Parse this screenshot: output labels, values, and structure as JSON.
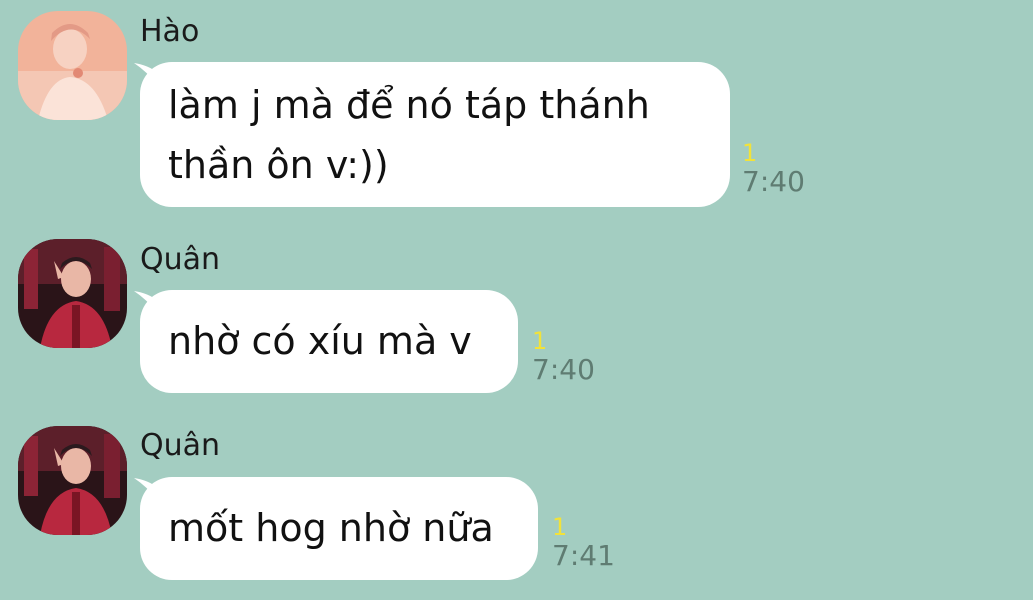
{
  "messages": [
    {
      "sender": "Hào",
      "avatar": "avatar-hao",
      "lines": [
        "làm j mà để nó táp thánh",
        "thần ôn v:))"
      ],
      "unread": "1",
      "time": "7:40"
    },
    {
      "sender": "Quân",
      "avatar": "avatar-quan",
      "lines": [
        "nhờ có xíu mà v"
      ],
      "unread": "1",
      "time": "7:40"
    },
    {
      "sender": "Quân",
      "avatar": "avatar-quan",
      "lines": [
        "mốt hog nhờ nữa"
      ],
      "unread": "1",
      "time": "7:41"
    }
  ],
  "colors": {
    "background": "#a3cdc1",
    "bubble": "#ffffff",
    "unread": "#f2e23a",
    "time": "#5f7c72"
  }
}
